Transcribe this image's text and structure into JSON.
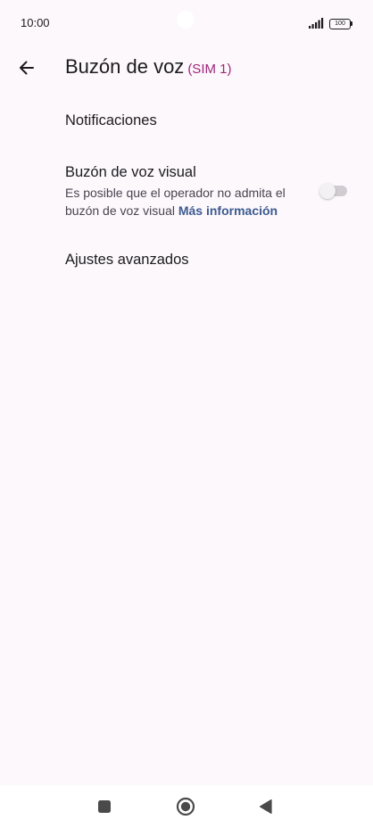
{
  "status_bar": {
    "time": "10:00",
    "battery": "100"
  },
  "app_bar": {
    "title": "Buzón de voz",
    "sim_label": "(SIM 1)",
    "back_icon": "arrow-left-icon"
  },
  "preferences": {
    "notifications": {
      "title": "Notificaciones"
    },
    "visual_voicemail": {
      "title": "Buzón de voz visual",
      "summary": "Es posible que el operador no admita el buzón de voz visual",
      "link": "Más información",
      "toggle_on": false
    },
    "advanced": {
      "title": "Ajustes avanzados"
    }
  },
  "nav_bar": {
    "recents_icon": "square-icon",
    "home_icon": "circle-icon",
    "back_icon": "triangle-back-icon"
  },
  "colors": {
    "background": "#fcf8fc",
    "sim_accent": "#a0267a",
    "link": "#3d5a90"
  }
}
